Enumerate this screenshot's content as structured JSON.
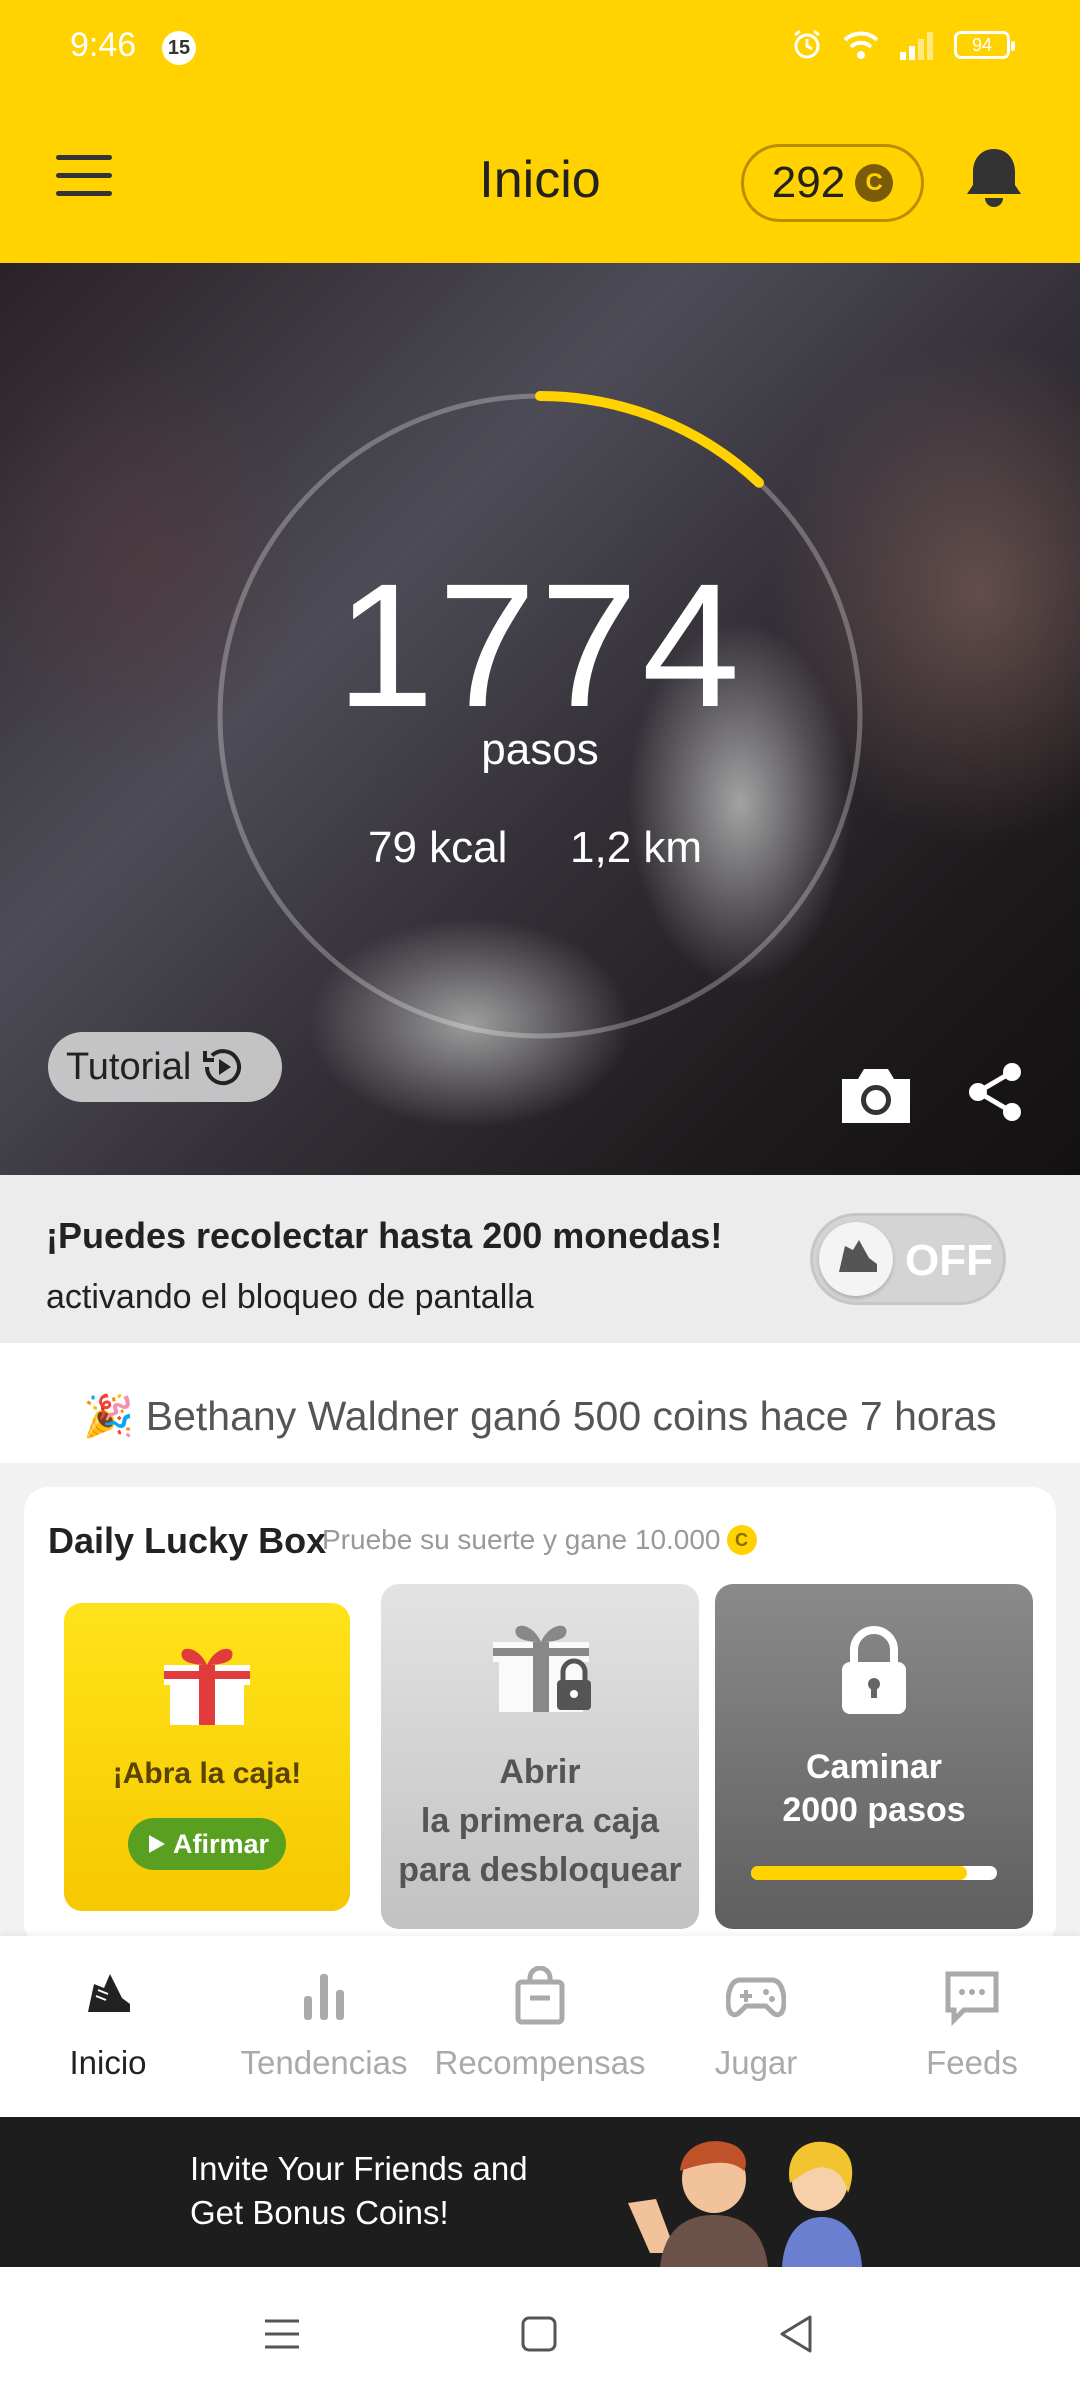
{
  "status_bar": {
    "time": "9:46",
    "notification_count": "15",
    "battery": "94"
  },
  "header": {
    "title": "Inicio",
    "coins": "292",
    "coin_symbol": "C"
  },
  "hero": {
    "steps": "1774",
    "steps_label": "pasos",
    "kcal": "79 kcal",
    "distance": "1,2 km",
    "tutorial_label": "Tutorial",
    "progress_fraction": 0.12
  },
  "lock_banner": {
    "headline": "¡Puedes recolectar hasta 200 monedas!",
    "subtitle": "activando el bloqueo de pantalla",
    "toggle_label": "OFF"
  },
  "ticker": {
    "text": "🎉 Bethany Waldner ganó 500 coins hace 7 horas"
  },
  "lucky_box": {
    "title": "Daily Lucky Box",
    "subtitle": "Pruebe su suerte y gane 10.000",
    "coin_symbol": "C",
    "box1": {
      "label": "¡Abra la caja!",
      "button": "Afirmar"
    },
    "box2": {
      "line1": "Abrir",
      "line2": "la primera caja",
      "line3": "para desbloquear"
    },
    "box3": {
      "line1": "Caminar",
      "line2": "2000 pasos",
      "progress_fraction": 0.88
    }
  },
  "bottom_nav": {
    "items": [
      {
        "label": "Inicio",
        "icon": "shoe-icon",
        "active": true
      },
      {
        "label": "Tendencias",
        "icon": "bar-chart-icon",
        "active": false
      },
      {
        "label": "Recompensas",
        "icon": "shopping-bag-icon",
        "active": false
      },
      {
        "label": "Jugar",
        "icon": "gamepad-icon",
        "active": false
      },
      {
        "label": "Feeds",
        "icon": "chat-icon",
        "active": false
      }
    ]
  },
  "ad_banner": {
    "line1": "Invite Your Friends and",
    "line2": "Get Bonus Coins!"
  },
  "colors": {
    "brand_yellow": "#FFD200",
    "go_green": "#5aa020"
  }
}
